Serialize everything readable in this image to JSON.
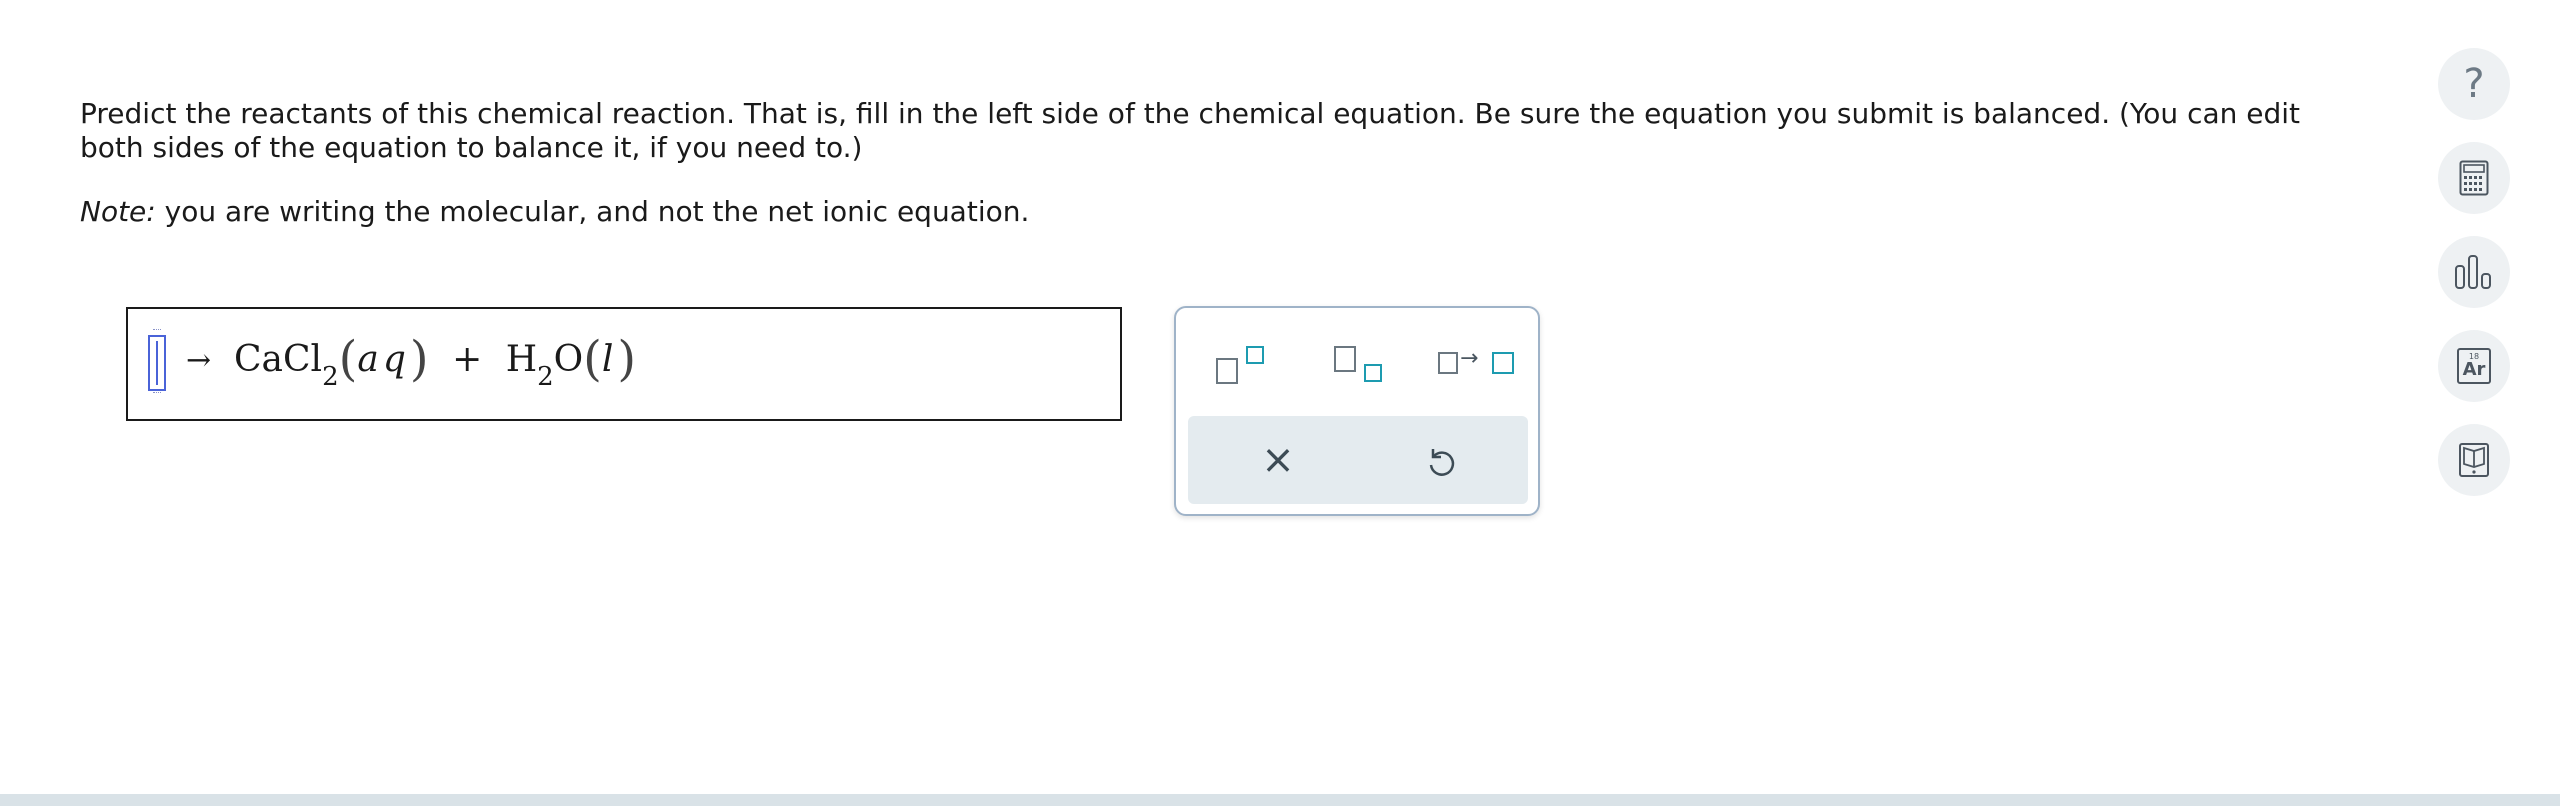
{
  "question": {
    "instructions": "Predict the reactants of this chemical reaction. That is, fill in the left side of the chemical equation. Be sure the equation you submit is balanced. (You can edit both sides of the equation to balance it, if you need to.)",
    "note_label": "Note:",
    "note_text": " you are writing the molecular, and not the net ionic equation."
  },
  "equation": {
    "arrow": "→",
    "product1": {
      "element": "CaCl",
      "subscript": "2",
      "state": "aq"
    },
    "plus": "+",
    "product2": {
      "element_a": "H",
      "subscript": "2",
      "element_b": "O",
      "state": "l"
    }
  },
  "palette": {
    "arrow_glyph": "→",
    "clear_glyph": "×",
    "undo_glyph": "↺"
  },
  "toolbar": {
    "help_glyph": "?",
    "periodic_number": "18",
    "periodic_symbol": "Ar"
  },
  "colors": {
    "cursor": "#4a63d8",
    "template_accent": "#1d9bb0",
    "palette_border": "#9fb3c8"
  }
}
